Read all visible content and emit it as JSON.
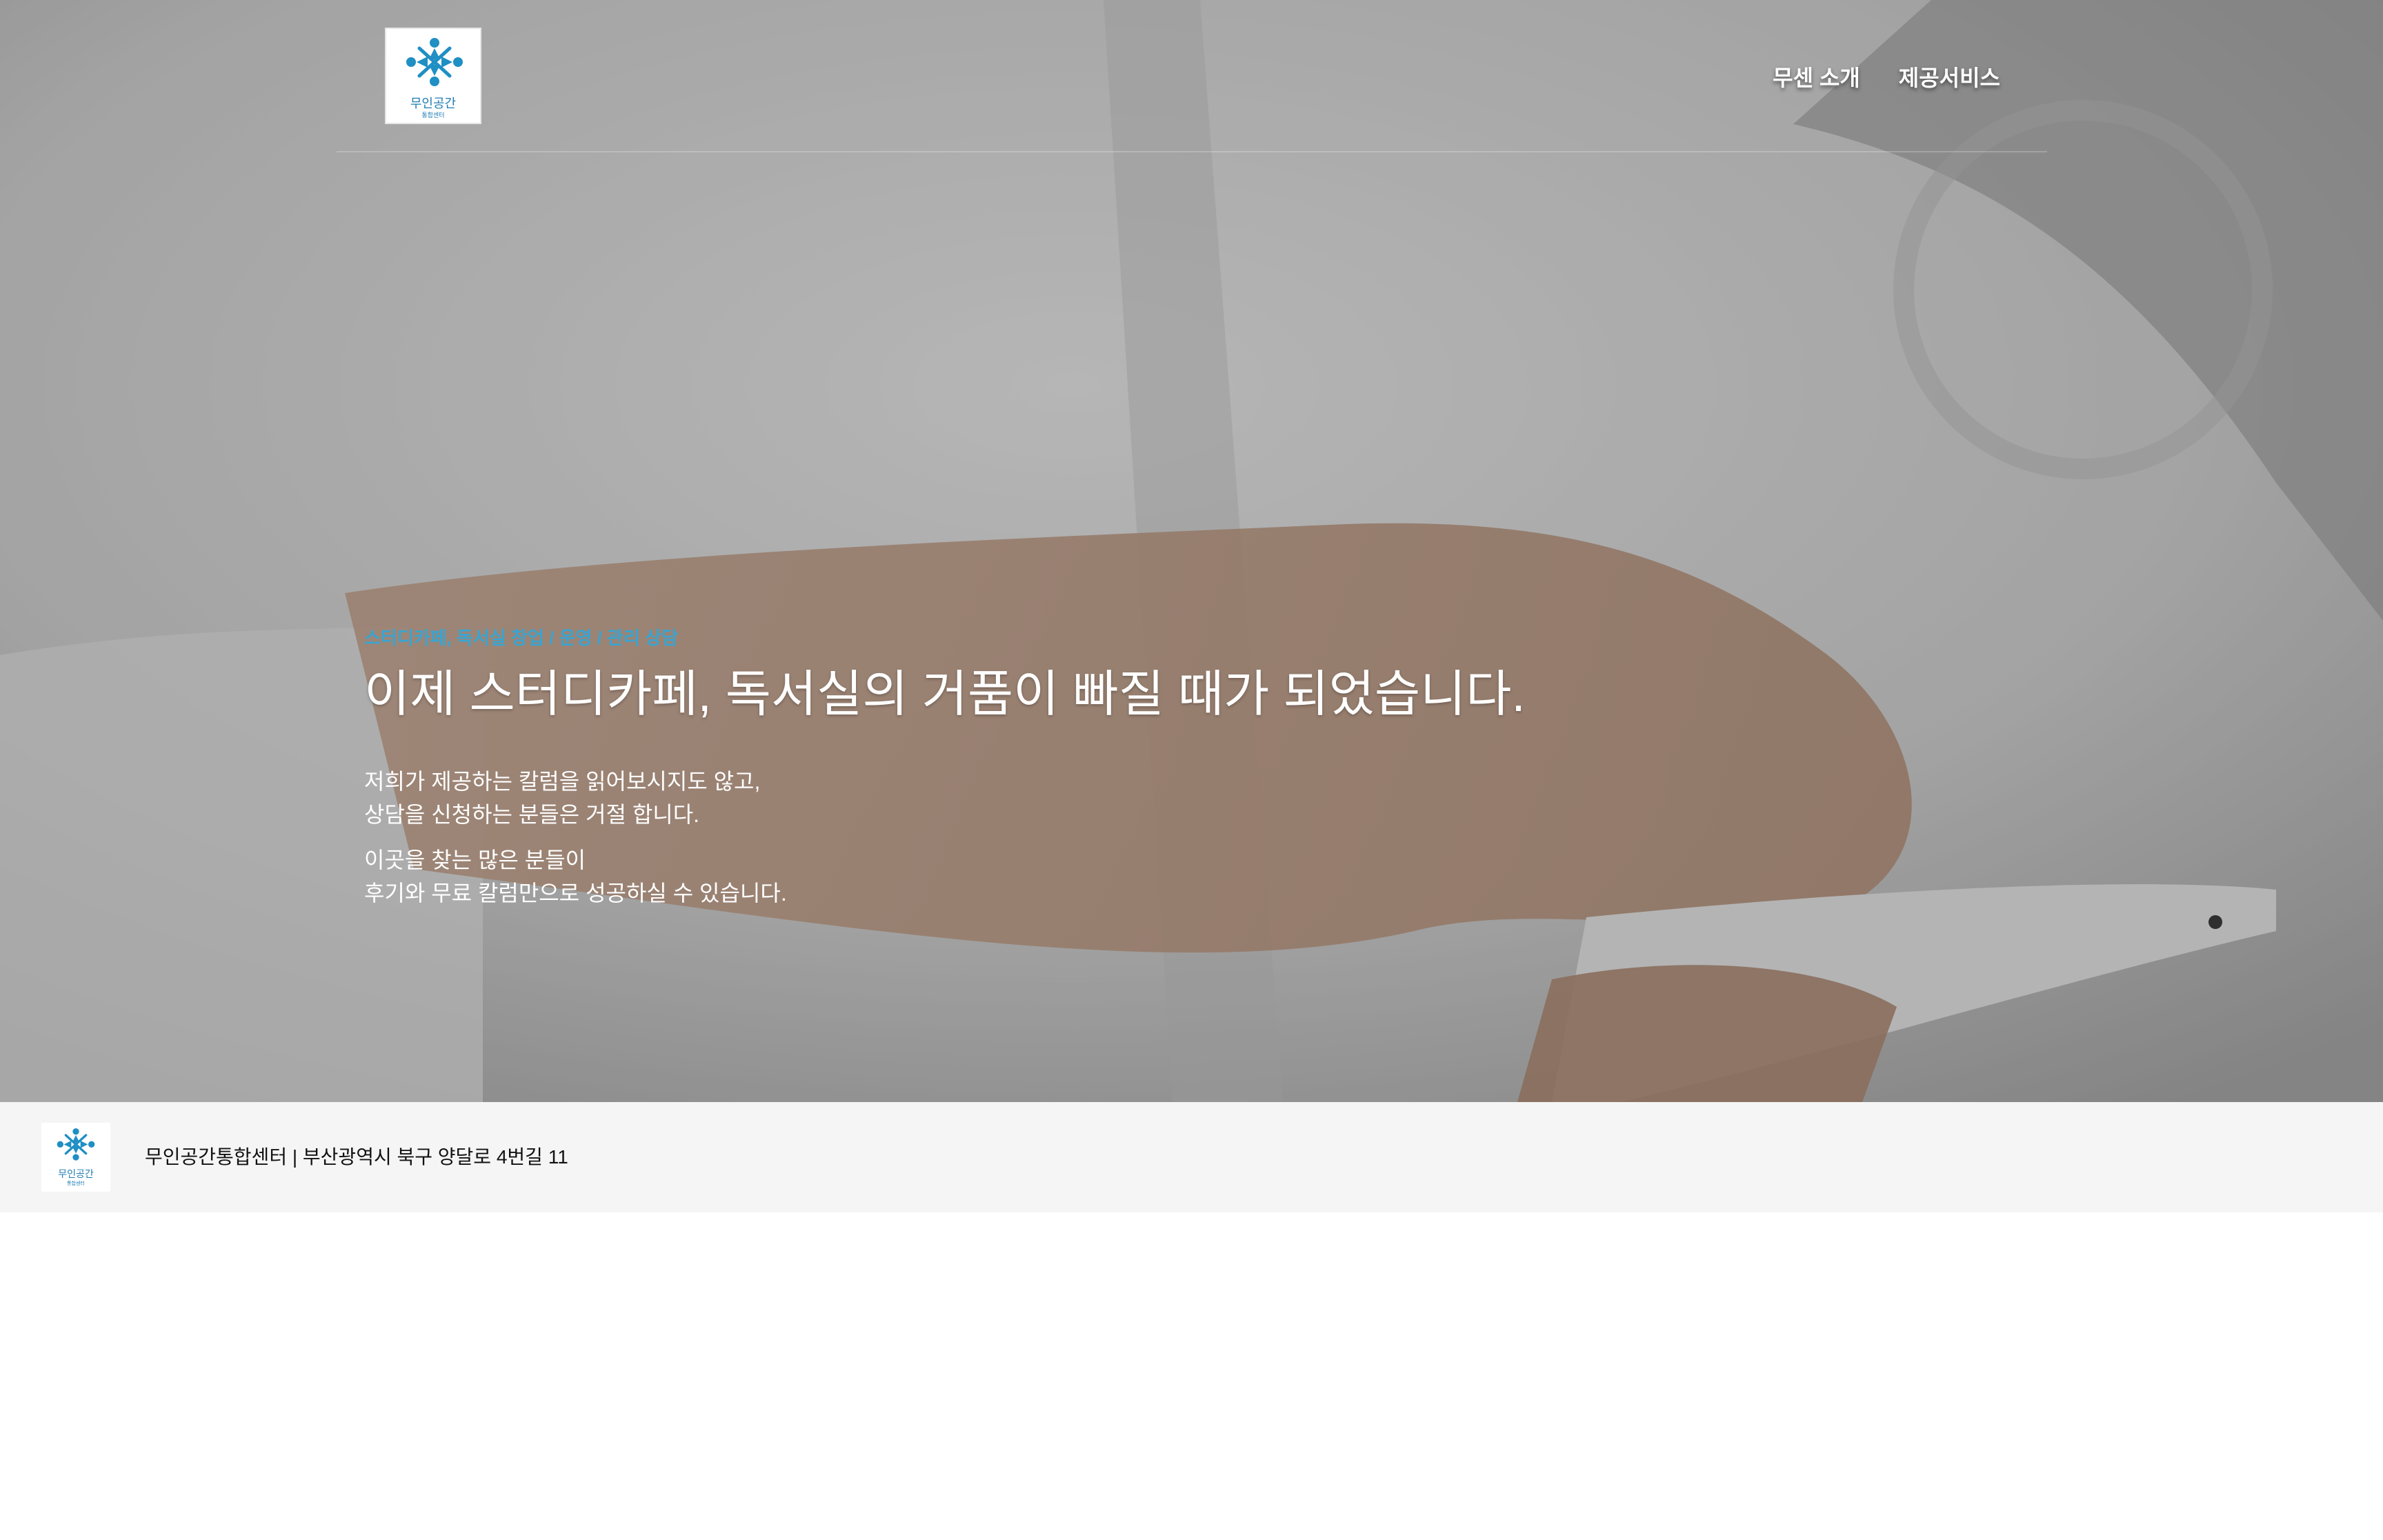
{
  "header": {
    "logo": {
      "name": "무인공간",
      "sub": "통합센터"
    },
    "nav": [
      {
        "label": "무센 소개"
      },
      {
        "label": "제공서비스"
      }
    ]
  },
  "hero": {
    "eyebrow": "스터디카페, 독서실 창업 / 운영 / 관리 상담",
    "headline": "이제 스터디카페, 독서실의 거품이 빠질 때가 되었습니다.",
    "para1": [
      "저희가 제공하는 칼럼을 읽어보시지도 않고,",
      "상담을 신청하는 분들은 거절 합니다."
    ],
    "para2": [
      "이곳을 찾는 많은 분들이",
      "후기와 무료 칼럼만으로 성공하실 수 있습니다."
    ]
  },
  "footer": {
    "text": "무인공간통합센터 | 부산광역시 북구 양달로 4번길 11"
  },
  "colors": {
    "accent": "#3aa4d0",
    "logo": "#1f7cb3",
    "footer_bg": "#f5f5f5"
  }
}
